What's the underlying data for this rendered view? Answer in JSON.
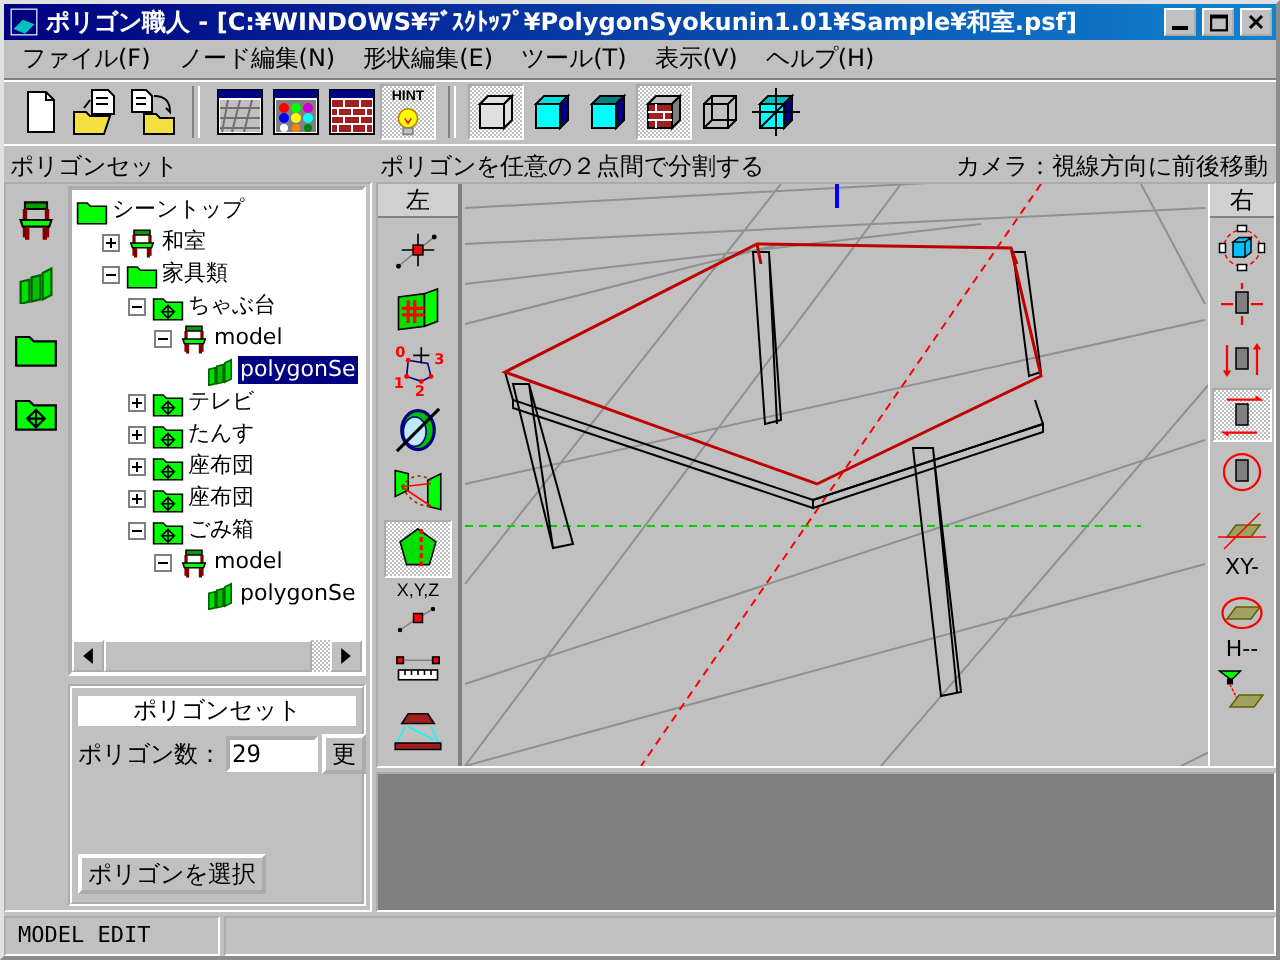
{
  "window": {
    "title": "ポリゴン職人 - [C:¥WINDOWS¥ﾃﾞｽｸﾄｯﾌﾟ¥PolygonSyokunin1.01¥Sample¥和室.psf]"
  },
  "menu": [
    "ファイル(F)",
    "ノード編集(N)",
    "形状編集(E)",
    "ツール(T)",
    "表示(V)",
    "ヘルプ(H)"
  ],
  "toolbar": {
    "groups": [
      {
        "buttons": [
          {
            "kind": "new",
            "pressed": false
          },
          {
            "kind": "open",
            "pressed": false
          },
          {
            "kind": "save",
            "pressed": false
          }
        ]
      },
      {
        "buttons": [
          {
            "kind": "grid-window",
            "pressed": false
          },
          {
            "kind": "palette-window",
            "pressed": false
          },
          {
            "kind": "brick-window",
            "pressed": false
          },
          {
            "kind": "hint",
            "label": "HINT",
            "pressed": true
          }
        ]
      },
      {
        "buttons": [
          {
            "kind": "cube-outline",
            "pressed": true
          },
          {
            "kind": "cube-solid",
            "pressed": false
          },
          {
            "kind": "cube-front",
            "pressed": false
          },
          {
            "kind": "cube-brick",
            "pressed": true
          },
          {
            "kind": "cube-wire",
            "pressed": false
          },
          {
            "kind": "cube-axis",
            "pressed": false
          }
        ]
      }
    ]
  },
  "left_panel": {
    "title": "ポリゴンセット",
    "tools": [
      {
        "kind": "model"
      },
      {
        "kind": "polygon"
      },
      {
        "kind": "folder"
      },
      {
        "kind": "group"
      }
    ],
    "tree": [
      {
        "label": "シーントップ",
        "kind": "folder",
        "selected": false,
        "children": [
          {
            "label": "和室",
            "kind": "model",
            "expanded": false,
            "selected": false
          },
          {
            "label": "家具類",
            "kind": "folder",
            "expanded": true,
            "selected": false,
            "children": [
              {
                "label": "ちゃぶ台",
                "kind": "group",
                "expanded": true,
                "selected": false,
                "children": [
                  {
                    "label": "model",
                    "kind": "model",
                    "expanded": true,
                    "selected": false,
                    "children": [
                      {
                        "label": "polygonSe",
                        "kind": "polygon",
                        "selected": true
                      }
                    ]
                  }
                ]
              },
              {
                "label": "テレビ",
                "kind": "group",
                "expanded": false,
                "selected": false
              },
              {
                "label": "たんす",
                "kind": "group",
                "expanded": false,
                "selected": false
              },
              {
                "label": "座布団",
                "kind": "group",
                "expanded": false,
                "selected": false
              },
              {
                "label": "座布団",
                "kind": "group",
                "expanded": false,
                "selected": false
              },
              {
                "label": "ごみ箱",
                "kind": "group",
                "expanded": true,
                "selected": false,
                "children": [
                  {
                    "label": "model",
                    "kind": "model",
                    "expanded": true,
                    "selected": false,
                    "children": [
                      {
                        "label": "polygonSe",
                        "kind": "polygon",
                        "selected": false
                      }
                    ]
                  }
                ]
              }
            ]
          }
        ]
      }
    ],
    "properties": {
      "title": "ポリゴンセット",
      "count_label": "ポリゴン数：",
      "count_value": "29",
      "apply_button": "更",
      "select_button": "ポリゴンを選択"
    }
  },
  "viewport": {
    "hint": "ポリゴンを任意の２点間で分割する",
    "camera_mode": "カメラ：視線方向に前後移動",
    "left_tools": {
      "title": "左",
      "items": [
        {
          "kind": "move-point",
          "selected": false
        },
        {
          "kind": "extrude",
          "selected": false
        },
        {
          "kind": "polygon-points",
          "labels": [
            "0",
            "1",
            "2",
            "3"
          ],
          "selected": false
        },
        {
          "kind": "rotate",
          "selected": false
        },
        {
          "kind": "bridge",
          "selected": false
        },
        {
          "kind": "split",
          "selected": true
        },
        {
          "kind": "xyz",
          "label": "X,Y,Z",
          "selected": false
        },
        {
          "kind": "measure",
          "selected": false
        },
        {
          "kind": "floor",
          "selected": false
        }
      ]
    },
    "right_tools": {
      "title": "右",
      "items": [
        {
          "kind": "orbit",
          "selected": false
        },
        {
          "kind": "pan",
          "selected": false
        },
        {
          "kind": "updown",
          "selected": false
        },
        {
          "kind": "forward",
          "selected": true
        },
        {
          "kind": "spin",
          "selected": false
        },
        {
          "kind": "grid",
          "selected": false
        },
        {
          "kind": "text",
          "label": "XY-"
        },
        {
          "kind": "grid-rotate",
          "selected": false
        },
        {
          "kind": "text",
          "label": "H--"
        },
        {
          "kind": "grid-light",
          "selected": false
        }
      ]
    }
  },
  "status_bar": [
    "MODEL EDIT"
  ]
}
